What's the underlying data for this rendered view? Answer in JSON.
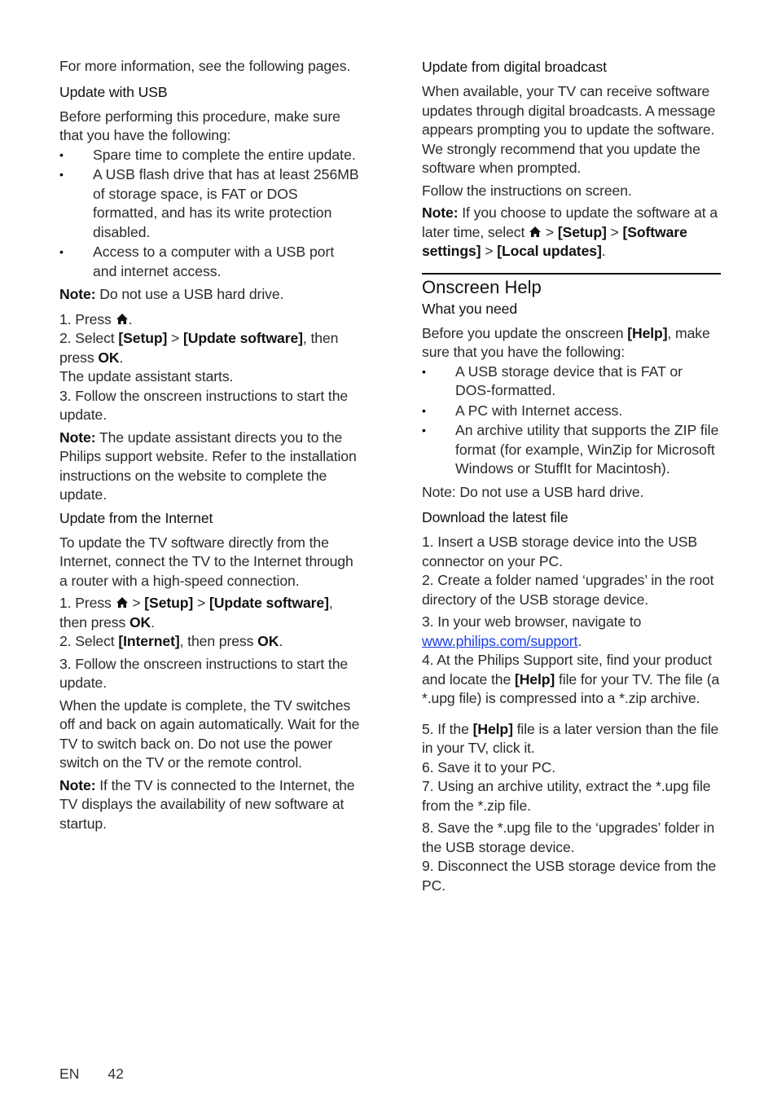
{
  "left": {
    "intro": "For more information, see the following pages.",
    "usb": {
      "heading": "Update with USB",
      "before": "Before performing this procedure, make sure that you have the following:",
      "bullets": [
        "Spare time to complete the entire update.",
        "A USB flash drive that has at least 256MB of storage space, is FAT or DOS formatted, and has its write protection disabled.",
        "Access to a computer with a USB port and internet access."
      ],
      "note_label": "Note:",
      "note_text": " Do not use a USB hard drive.",
      "step1_prefix": "1. Press ",
      "step1_suffix": ".",
      "step2_prefix": "2. Select ",
      "setup": "[Setup]",
      "gt": " > ",
      "update_software": "[Update software]",
      "step2_mid": ", then press ",
      "ok": "OK",
      "period": ".",
      "assistant": "The update assistant starts.",
      "step3": "3. Follow the onscreen instructions to start the update.",
      "note2_label": "Note:",
      "note2_text": " The update assistant directs you to the Philips support website. Refer to the installation instructions on the website to complete the update."
    },
    "internet": {
      "heading": "Update from the Internet",
      "intro": "To update the TV software directly from the Internet, connect the TV to the Internet through a router with a high-speed connection.",
      "step1_prefix": "1. Press ",
      "gt": " > ",
      "setup": "[Setup]",
      "update_software": "[Update software]",
      "step1_suffix": ", then press ",
      "ok": "OK",
      "period": ".",
      "step2_prefix": "2. Select ",
      "internet": "[Internet]",
      "step2_mid": ", then press ",
      "step3": "3. Follow the onscreen instructions to start the update.",
      "complete": "When the update is complete, the TV switches off and back on again automatically. Wait for the TV to switch back on. Do not use the power switch on the TV or the remote control.",
      "note_label": "Note:",
      "note_text": " If the TV is connected to the Internet, the TV displays the availability of new software at startup."
    }
  },
  "right": {
    "broadcast": {
      "heading": "Update from digital broadcast",
      "body": "When available, your TV can receive software updates through digital broadcasts. A message appears prompting you to update the software. We strongly recommend that you update the software when prompted.",
      "follow": "Follow the instructions on screen.",
      "note_label": "Note:",
      "note_prefix": " If you choose to update the software at a later time, select ",
      "gt": " > ",
      "setup": "[Setup]",
      "software_settings": "[Software settings]",
      "local_updates": "[Local updates]",
      "period": "."
    },
    "help": {
      "title": "Onscreen Help",
      "need_heading": "What you need",
      "before_prefix": "Before you update the onscreen ",
      "help_label": "[Help]",
      "before_suffix": ", make sure that you have the following:",
      "bullets": [
        "A USB storage device that is FAT or DOS-formatted.",
        "A PC with Internet access.",
        "An archive utility that supports the ZIP file format (for example, WinZip for Microsoft Windows or StuffIt for Macintosh)."
      ],
      "note": "Note: Do not use a USB hard drive.",
      "download_heading": "Download the latest file",
      "step1": "1. Insert a USB storage device into the USB connector on your PC.",
      "step2": "2. Create a folder named ‘upgrades’ in the root directory of the USB storage device.",
      "step3_prefix": "3. In your web browser, navigate to ",
      "link": "www.philips.com/support",
      "period": ".",
      "step4_prefix": "4. At the Philips Support site, find your product and locate the ",
      "step4_suffix": " file for your TV. The file (a *.upg file) is compressed into a *.zip archive.",
      "step5_prefix": "5. If the ",
      "step5_suffix": " file is a later version than the file in your TV, click it.",
      "step6": "6. Save it to your PC.",
      "step7": "7. Using an archive utility, extract the *.upg file from the *.zip file.",
      "step8": "8. Save the *.upg file to the ‘upgrades’ folder in the USB storage device.",
      "step9": "9. Disconnect the USB storage device from the PC."
    }
  },
  "footer": {
    "lang": "EN",
    "page": "42"
  },
  "icons": {
    "home": "home-icon",
    "bullet": "•"
  },
  "colors": {
    "link": "#1a3ee8",
    "text": "#2a2a2a"
  }
}
